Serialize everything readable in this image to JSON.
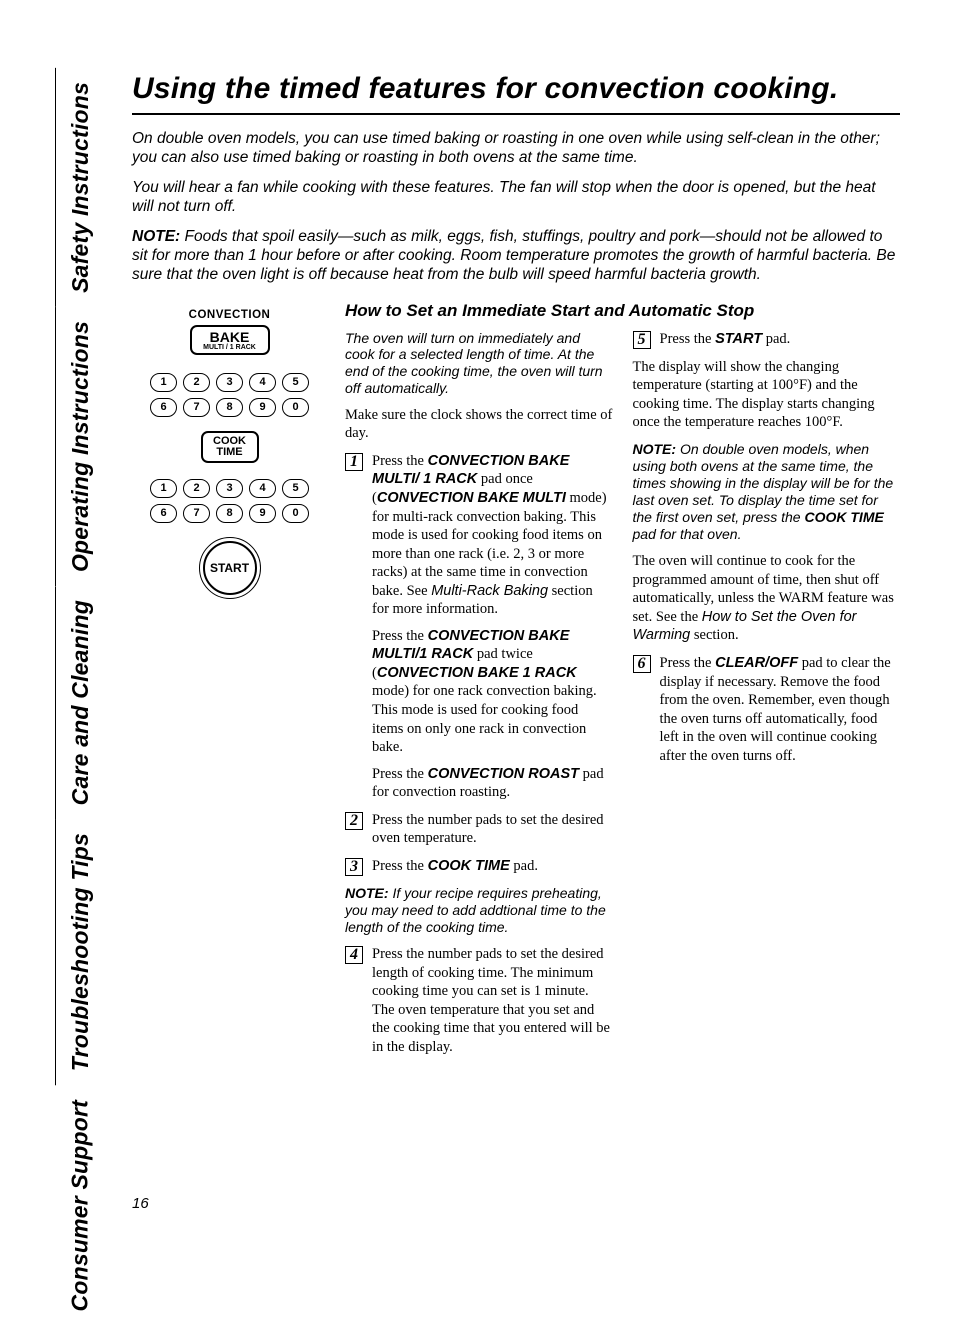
{
  "tabs": {
    "safety": "Safety Instructions",
    "operating": "Operating Instructions",
    "care": "Care and Cleaning",
    "trouble": "Troubleshooting Tips",
    "consumer": "Consumer Support"
  },
  "title": "Using the timed features for convection cooking.",
  "intro": {
    "p1": "On double oven models, you can use timed baking or roasting in one oven while using self-clean in the other; you can also use timed baking or roasting in both ovens at the same time.",
    "p2": "You will hear a fan while cooking with these features. The fan will stop when the door is opened, but the heat will not turn off.",
    "note_label": "NOTE:",
    "note_text": " Foods that spoil easily—such as milk, eggs, fish, stuffings, poultry and pork—should not be allowed to sit for more than 1 hour before or after cooking. Room temperature promotes the growth of harmful bacteria. Be sure that the oven light is off because heat from the bulb will speed harmful bacteria growth."
  },
  "illus": {
    "convection": "CONVECTION",
    "bake": "BAKE",
    "bake_sub": "MULTI / 1 RACK",
    "row1": [
      "1",
      "2",
      "3",
      "4",
      "5"
    ],
    "row2": [
      "6",
      "7",
      "8",
      "9",
      "0"
    ],
    "cooktime1": "COOK",
    "cooktime2": "TIME",
    "start": "START"
  },
  "howto": {
    "heading": "How to Set an Immediate Start and Automatic Stop",
    "lead": "The oven will turn on immediately and cook for a selected length of time. At the end of the cooking time, the oven will turn off automatically.",
    "clock": "Make sure the clock shows the correct time of day.",
    "s1": {
      "n": "1",
      "p1a": "Press the ",
      "p1b": "CONVECTION BAKE MULTI/ 1 RACK",
      "p1c": " pad once (",
      "p1d": "CONVECTION BAKE MULTI",
      "p1e": " mode) for multi-rack convection baking. This mode is used for cooking food items on more than one rack (i.e. 2, 3 or more racks) at the same time in convection bake. See ",
      "p1f": "Multi-Rack Baking",
      "p1g": " section for more information.",
      "p2a": "Press the ",
      "p2b": "CONVECTION BAKE MULTI/1 RACK",
      "p2c": " pad twice (",
      "p2d": "CONVECTION BAKE 1 RACK",
      "p2e": " mode) for one rack convection baking. This mode is used for cooking food items on only one rack in convection bake.",
      "p3a": "Press the ",
      "p3b": "CONVECTION ROAST",
      "p3c": " pad for convection roasting."
    },
    "s2": {
      "n": "2",
      "t": "Press the number pads to set the desired oven temperature."
    },
    "s3": {
      "n": "3",
      "ta": "Press the ",
      "tb": "COOK TIME",
      "tc": " pad."
    },
    "note1_label": "NOTE:",
    "note1_text": " If your recipe requires preheating, you may need to add addtional time to the length of the cooking time.",
    "s4": {
      "n": "4",
      "t": "Press the number pads to set the desired length of cooking time. The minimum cooking time you can set is 1 minute. The oven temperature that you set and the cooking time that you entered will be in the display."
    },
    "s5": {
      "n": "5",
      "ta": "Press the ",
      "tb": "START",
      "tc": " pad."
    },
    "after5": "The display will show the changing temperature (starting at 100°F) and the cooking time. The display starts changing once the temperature reaches 100°F.",
    "note2_label": "NOTE:",
    "note2_text_a": " On double oven models, when using both ovens at the same time, the times showing in the display will be for the last oven set. To display the time set for the first oven set, press the ",
    "note2_text_b": "COOK TIME",
    "note2_text_c": " pad for that oven.",
    "after_note2a": "The oven will continue to cook for the programmed amount of time, then shut off automatically, unless the WARM feature was set. See the ",
    "after_note2b": "How to Set the Oven for Warming",
    "after_note2c": " section.",
    "s6": {
      "n": "6",
      "ta": "Press the ",
      "tb": "CLEAR/OFF",
      "tc": " pad to clear the display if necessary. Remove the food from the oven. Remember, even though the oven turns off automatically, food left in the oven will continue cooking after the oven turns off."
    }
  },
  "page": "16"
}
